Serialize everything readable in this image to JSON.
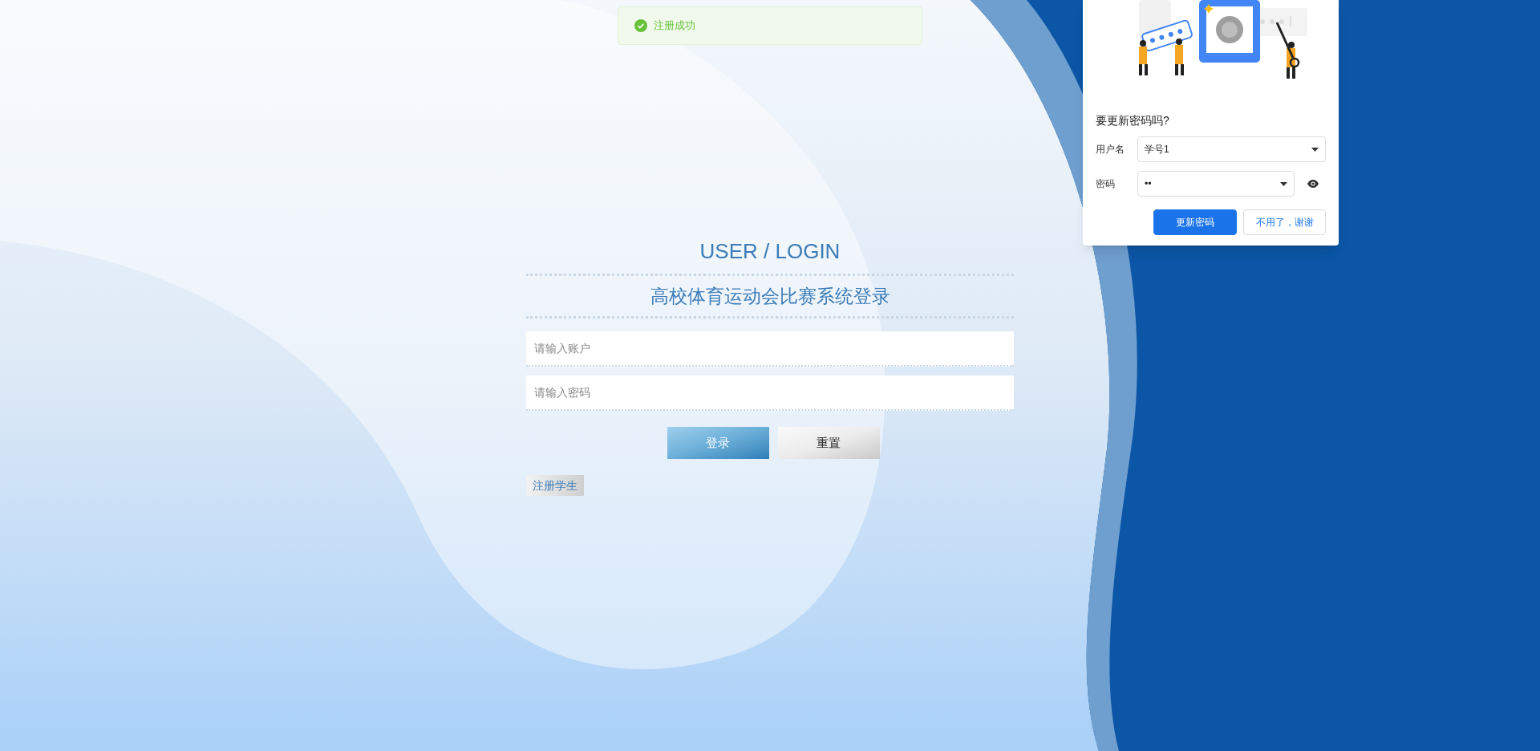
{
  "toast": {
    "kind": "success",
    "message": "注册成功"
  },
  "login": {
    "title": "USER / LOGIN",
    "subtitle": "高校体育运动会比赛系统登录",
    "fields": [
      {
        "placeholder": "请输入账户"
      },
      {
        "placeholder": "请输入密码"
      }
    ],
    "buttons": [
      {
        "kind": "primary",
        "label": "登录"
      },
      {
        "kind": "secondary",
        "label": "重置"
      }
    ],
    "register_link": "注册学生"
  },
  "password_prompt": {
    "question": "要更新密码吗?",
    "fields": [
      {
        "label": "用户名",
        "value": "学号1",
        "kind": "text"
      },
      {
        "label": "密码",
        "value": "••",
        "kind": "password"
      }
    ],
    "buttons": [
      {
        "kind": "primary",
        "label": "更新密码"
      },
      {
        "kind": "secondary",
        "label": "不用了，谢谢"
      }
    ]
  }
}
